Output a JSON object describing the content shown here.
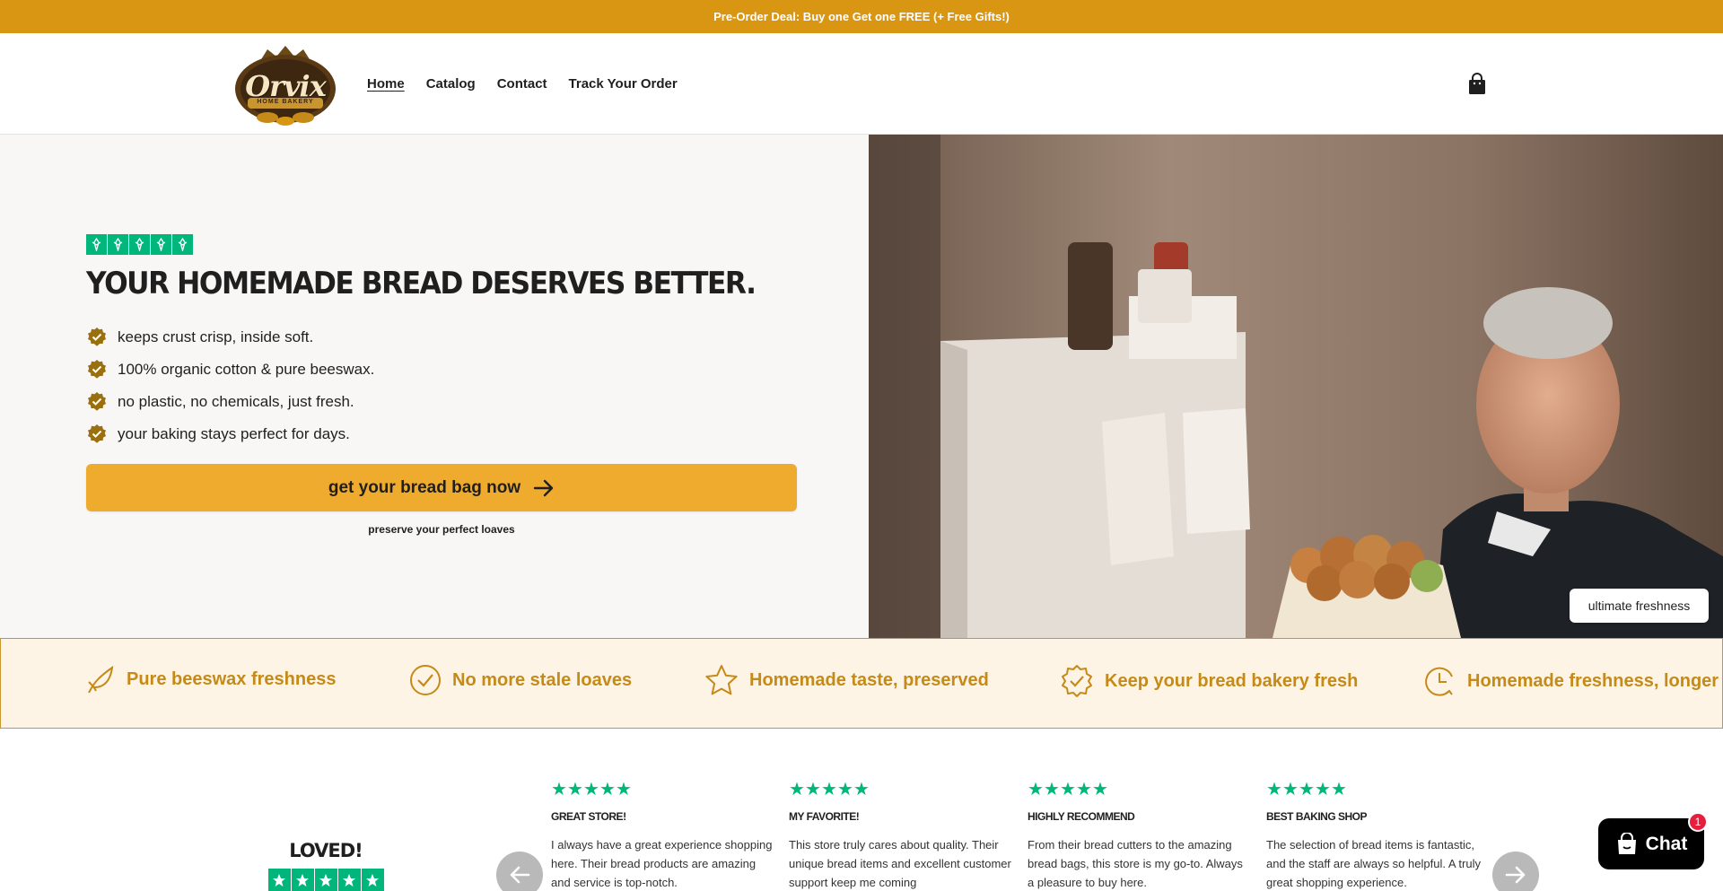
{
  "announcement": {
    "text": "Pre-Order Deal: Buy one Get one FREE (+ Free Gifts!)"
  },
  "header": {
    "logo": {
      "name": "Orvix",
      "subtitle": "HOME BAKERY"
    },
    "nav": [
      {
        "label": "Home",
        "active": true
      },
      {
        "label": "Catalog",
        "active": false
      },
      {
        "label": "Contact",
        "active": false
      },
      {
        "label": "Track Your Order",
        "active": false
      }
    ],
    "cart_icon": "shopping-bag-icon"
  },
  "hero": {
    "rating_stars": 5,
    "title": "YOUR HOMEMADE BREAD DESERVES BETTER.",
    "bullets": [
      "keeps crust crisp, inside soft.",
      "100% organic cotton & pure beeswax.",
      "no plastic, no chemicals, just fresh.",
      "your baking stays perfect for days."
    ],
    "cta_label": "get your bread bag now",
    "cta_subtext": "preserve your perfect loaves",
    "image_tag": "ultimate freshness"
  },
  "features": [
    {
      "icon": "leaf-icon",
      "label": "Pure beeswax freshness"
    },
    {
      "icon": "check-circle-icon",
      "label": "No more stale loaves"
    },
    {
      "icon": "star-icon",
      "label": "Homemade taste, preserved"
    },
    {
      "icon": "badge-check-icon",
      "label": "Keep your bread bakery fresh"
    },
    {
      "icon": "clock-icon",
      "label": "Homemade freshness, longer"
    }
  ],
  "reviews": {
    "heading": "LOVED!",
    "items": [
      {
        "stars": 5,
        "title": "GREAT STORE!",
        "text": "I always have a great experience shopping here. Their bread products are amazing and service is top-notch."
      },
      {
        "stars": 5,
        "title": "MY FAVORITE!",
        "text": "This store truly cares about quality. Their unique bread items and excellent customer support keep me coming"
      },
      {
        "stars": 5,
        "title": "HIGHLY RECOMMEND",
        "text": "From their bread cutters to the amazing bread bags, this store is my go-to. Always a pleasure to buy here."
      },
      {
        "stars": 5,
        "title": "BEST BAKING SHOP",
        "text": "The selection of bread items is fantastic, and the staff are always so helpful. A truly great shopping experience."
      }
    ]
  },
  "chat": {
    "label": "Chat",
    "badge_count": "1"
  },
  "colors": {
    "announcement_bg": "#d89613",
    "cta_bg": "#eeab2e",
    "feature_text": "#c58a17",
    "feature_bg": "#fdf4e5",
    "trustpilot_green": "#00b67a",
    "badge_olive": "#9a6f0f"
  }
}
